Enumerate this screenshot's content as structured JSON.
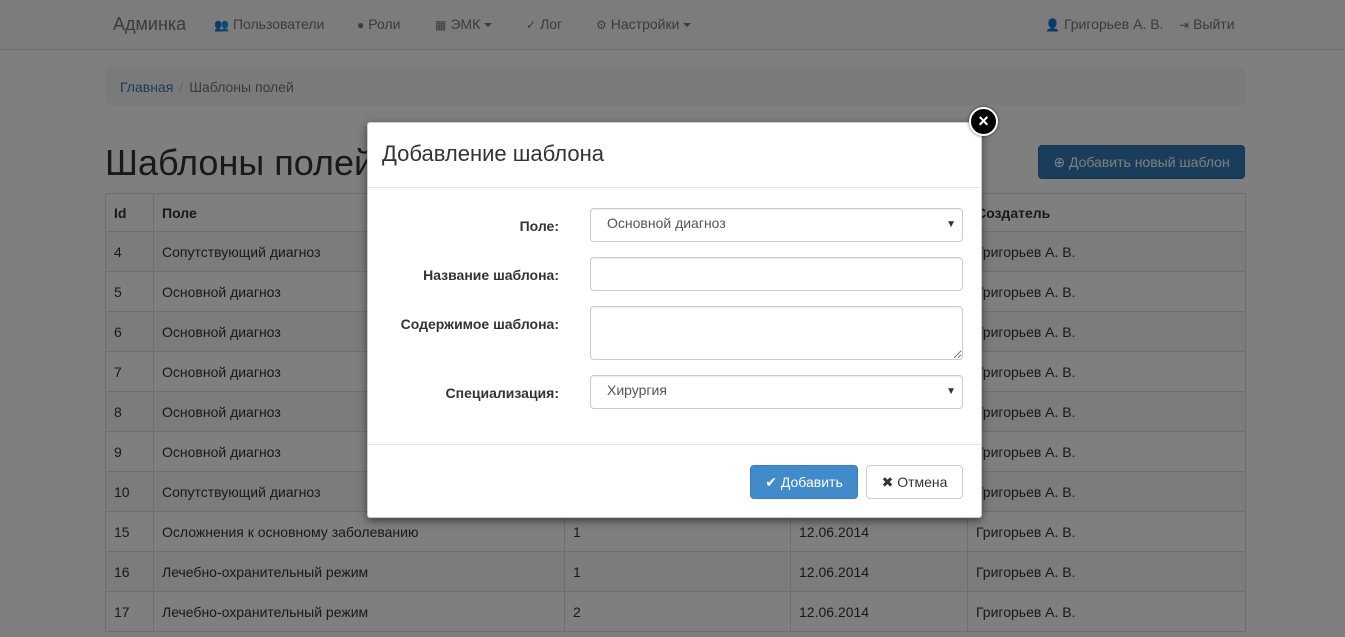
{
  "navbar": {
    "brand": "Админка",
    "items": [
      {
        "label": "Пользователи",
        "icon": "👥"
      },
      {
        "label": "Роли",
        "icon": "●"
      },
      {
        "label": "ЭМК",
        "icon": "▦"
      },
      {
        "label": "Лог",
        "icon": "✓"
      },
      {
        "label": "Настройки",
        "icon": "⚙"
      }
    ],
    "user": "Григорьев А. В.",
    "logout": "Выйти"
  },
  "breadcrumb": {
    "home": "Главная",
    "current": "Шаблоны полей"
  },
  "page": {
    "title": "Шаблоны полей",
    "add_button": "Добавить новый шаблон"
  },
  "table": {
    "headers": [
      "Id",
      "Поле",
      "",
      "",
      "Создатель"
    ],
    "rows": [
      [
        "4",
        "Сопутствующий диагноз",
        "",
        "",
        "Григорьев А. В."
      ],
      [
        "5",
        "Основной диагноз",
        "",
        "",
        "Григорьев А. В."
      ],
      [
        "6",
        "Основной диагноз",
        "",
        "",
        "Григорьев А. В."
      ],
      [
        "7",
        "Основной диагноз",
        "",
        "",
        "Григорьев А. В."
      ],
      [
        "8",
        "Основной диагноз",
        "",
        "",
        "Григорьев А. В."
      ],
      [
        "9",
        "Основной диагноз",
        "",
        "",
        "Григорьев А. В."
      ],
      [
        "10",
        "Сопутствующий диагноз",
        "",
        "",
        "Григорьев А. В."
      ],
      [
        "15",
        "Осложнения к основному заболеванию",
        "1",
        "12.06.2014",
        "Григорьев А. В."
      ],
      [
        "16",
        "Лечебно-охранительный режим",
        "1",
        "12.06.2014",
        "Григорьев А. В."
      ],
      [
        "17",
        "Лечебно-охранительный режим",
        "2",
        "12.06.2014",
        "Григорьев А. В."
      ]
    ]
  },
  "modal": {
    "title": "Добавление шаблона",
    "field_label": "Поле:",
    "field_value": "Основной диагноз",
    "name_label": "Название шаблона:",
    "name_value": "",
    "content_label": "Содержимое шаблона:",
    "content_value": "",
    "spec_label": "Специализация:",
    "spec_value": "Хирургия",
    "add_button": "Добавить",
    "cancel_button": "Отмена"
  }
}
